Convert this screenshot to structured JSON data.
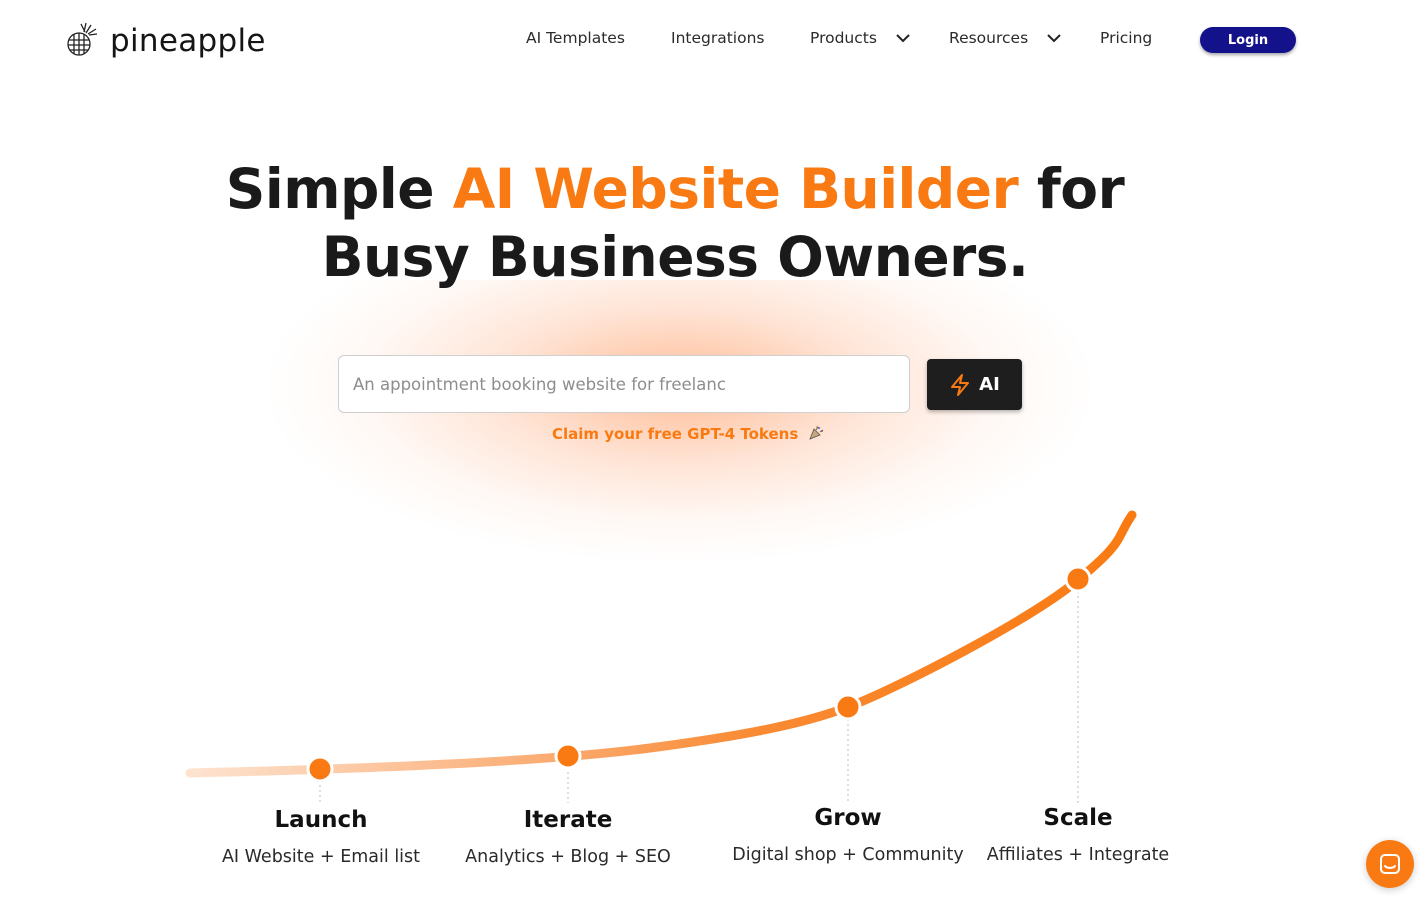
{
  "brand": {
    "name": "pineapple",
    "logo_icon": "pineapple-icon"
  },
  "nav": {
    "items": [
      {
        "label": "AI Templates",
        "has_dropdown": false
      },
      {
        "label": "Integrations",
        "has_dropdown": false
      },
      {
        "label": "Products",
        "has_dropdown": true
      },
      {
        "label": "Resources",
        "has_dropdown": true
      },
      {
        "label": "Pricing",
        "has_dropdown": false
      }
    ],
    "login_label": "Login"
  },
  "hero": {
    "headline_part1": "Simple ",
    "headline_accent": "AI Website Builder",
    "headline_part2": " for",
    "headline_line2": "Busy Business Owners.",
    "input_placeholder": "An appointment booking website for freelanc",
    "ai_button_label": "AI",
    "ai_button_icon": "lightning-icon",
    "claim_text": "Claim your free GPT-4 Tokens",
    "claim_icon": "party-popper-icon"
  },
  "growth": {
    "stages": [
      {
        "title": "Launch",
        "subtitle": "AI Website + Email list"
      },
      {
        "title": "Iterate",
        "subtitle": "Analytics + Blog + SEO"
      },
      {
        "title": "Grow",
        "subtitle": "Digital shop + Community"
      },
      {
        "title": "Scale",
        "subtitle": "Affiliates + Integrate"
      }
    ]
  },
  "chat": {
    "icon": "chat-icon"
  },
  "colors": {
    "accent": "#f97a12",
    "login_bg": "#13128a",
    "ai_button_bg": "#1e1e1e",
    "text": "#1a1a1a"
  }
}
